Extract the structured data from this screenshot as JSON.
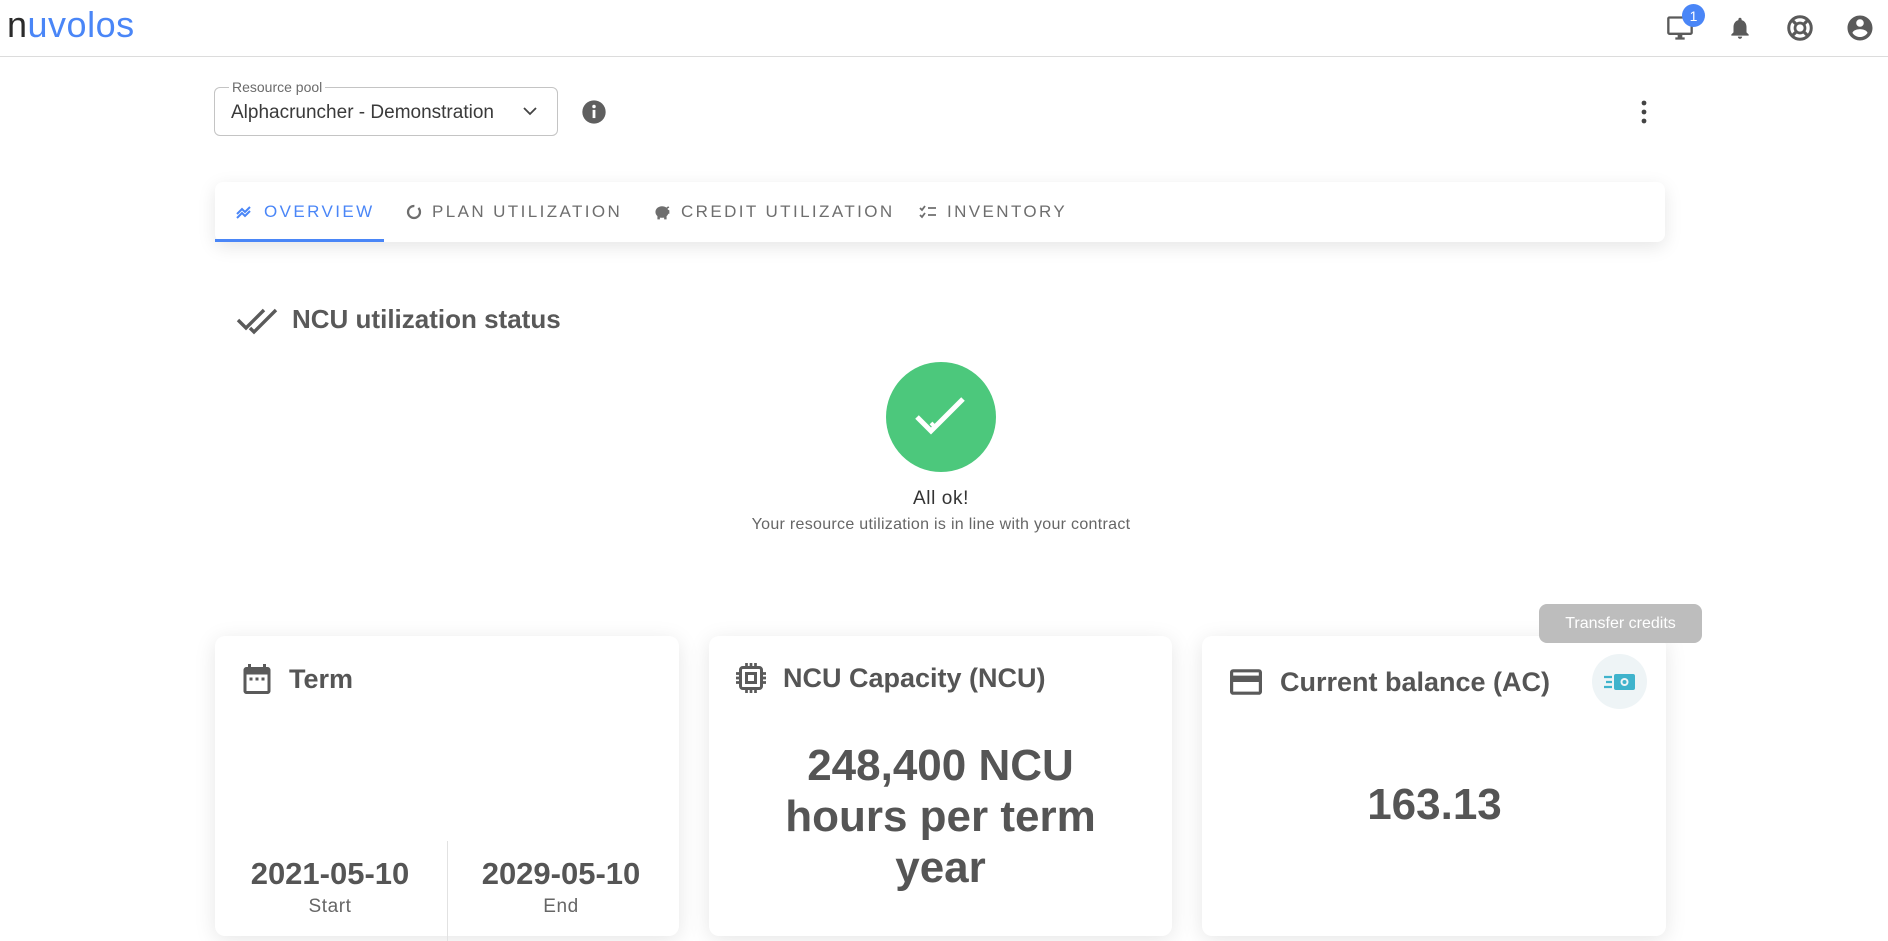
{
  "app": {
    "logo_n": "n",
    "logo_rest": "uvolos",
    "notification_count": "1"
  },
  "top_icons": [
    "monitor-icon",
    "bell-icon",
    "lifebuoy-icon",
    "account-circle-icon"
  ],
  "resource_pool": {
    "label": "Resource pool",
    "value": "Alphacruncher - Demonstration"
  },
  "tabs": [
    {
      "label": "OVERVIEW",
      "icon": "trending-icon",
      "active": true
    },
    {
      "label": "PLAN UTILIZATION",
      "icon": "donut-icon",
      "active": false
    },
    {
      "label": "CREDIT UTILIZATION",
      "icon": "piggy-bank-icon",
      "active": false
    },
    {
      "label": "INVENTORY",
      "icon": "checklist-icon",
      "active": false
    }
  ],
  "status": {
    "section_title": "NCU utilization status",
    "title": "All ok!",
    "description": "Your resource utilization is in line with your contract"
  },
  "transfer_button": "Transfer credits",
  "term_card": {
    "title": "Term",
    "start_date": "2021-05-10",
    "start_label": "Start",
    "end_date": "2029-05-10",
    "end_label": "End"
  },
  "capacity_card": {
    "title": "NCU Capacity (NCU)",
    "value": "248,400 NCU hours per term year"
  },
  "balance_card": {
    "title": "Current balance (AC)",
    "value": "163.13"
  },
  "colors": {
    "accent": "#4a86f7",
    "status_ok": "#4cc87c",
    "cash_icon": "#3fb3cc",
    "text": "#555555"
  }
}
